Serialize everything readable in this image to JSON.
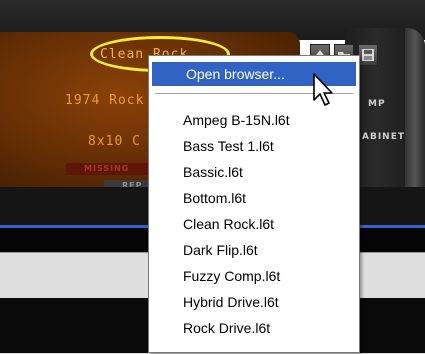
{
  "lcd": {
    "preset_name": "Clean Rock",
    "amp_model": "1974 Rock",
    "cab_model": "8x10 C",
    "missing_label": "MISSING",
    "replace_label": "REP"
  },
  "side_labels": {
    "amp": "MP",
    "cabinet": "ABINET"
  },
  "preset_buttons": [
    "up-arrow",
    "folder",
    "save"
  ],
  "menu": {
    "open_browser": "Open browser...",
    "items": [
      "Ampeg B-15N.l6t",
      "Bass Test 1.l6t",
      "Bassic.l6t",
      "Bottom.l6t",
      "Clean Rock.l6t",
      "Dark Flip.l6t",
      "Fuzzy Comp.l6t",
      "Hybrid Drive.l6t",
      "Rock Drive.l6t"
    ]
  },
  "colors": {
    "accent_selection": "#3163c5",
    "lcd_text": "#f09a2a",
    "highlight": "#f5ee2a"
  }
}
